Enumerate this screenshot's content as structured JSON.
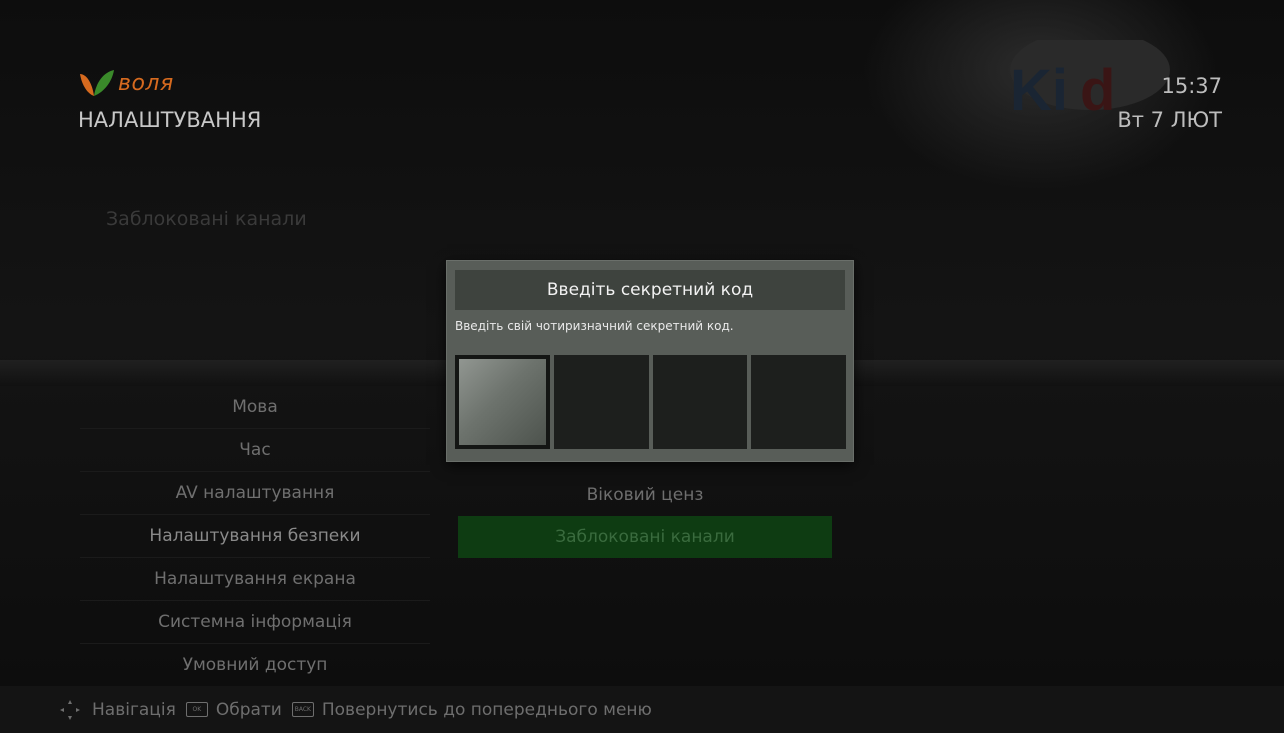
{
  "header": {
    "logo_text": "воля",
    "title": "НАЛАШТУВАННЯ",
    "time": "15:37",
    "date": "Вт 7 ЛЮТ"
  },
  "section_header": "Заблоковані канали",
  "left_menu": {
    "items": [
      {
        "label": "Мова"
      },
      {
        "label": "Час"
      },
      {
        "label": "AV налаштування"
      },
      {
        "label": "Налаштування безпеки"
      },
      {
        "label": "Налаштування екрана"
      },
      {
        "label": "Системна інформація"
      },
      {
        "label": "Умовний доступ"
      }
    ]
  },
  "submenu": {
    "items": [
      {
        "label": "Віковий ценз"
      },
      {
        "label": "Заблоковані канали"
      }
    ]
  },
  "dialog": {
    "title": "Введіть секретний код",
    "description": "Введіть свій чотиризначний секретний код.",
    "code_digits": [
      "",
      "",
      "",
      ""
    ]
  },
  "footer": {
    "navigate_label": "Навігація",
    "ok_key": "OK",
    "select_label": "Обрати",
    "back_key": "BACK",
    "back_label": "Повернутись до попереднього меню"
  },
  "colors": {
    "brand_orange": "#d66a1f",
    "brand_green": "#3a8a2a",
    "selected_bg": "#0e3c12",
    "dialog_bg": "#585d58"
  }
}
